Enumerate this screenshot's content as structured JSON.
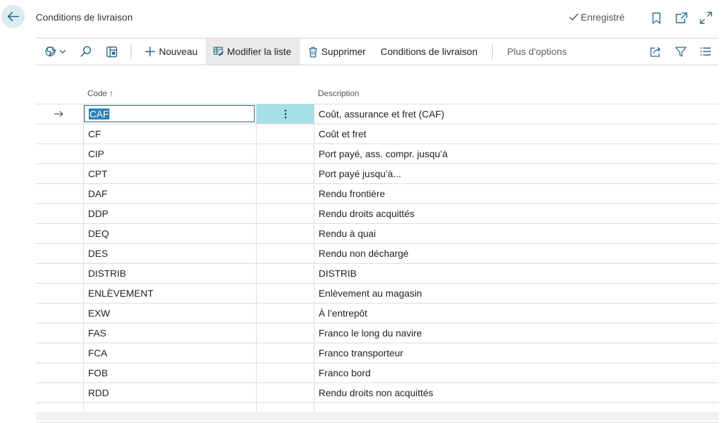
{
  "header": {
    "title": "Conditions de livraison",
    "saved_label": "Enregistré"
  },
  "toolbar": {
    "new_label": "Nouveau",
    "edit_list_label": "Modifier la liste",
    "delete_label": "Supprimer",
    "shipment_terms_label": "Conditions de livraison",
    "more_options_label": "Plus d'options"
  },
  "columns": {
    "code": "Code",
    "sort_indicator": "↑",
    "description": "Description"
  },
  "rows": [
    {
      "code": "CAF",
      "description": "Coût, assurance et fret (CAF)"
    },
    {
      "code": "CF",
      "description": "Coût et fret"
    },
    {
      "code": "CIP",
      "description": "Port payé, ass. compr. jusqu’à"
    },
    {
      "code": "CPT",
      "description": "Port payé jusqu’à..."
    },
    {
      "code": "DAF",
      "description": "Rendu frontière"
    },
    {
      "code": "DDP",
      "description": "Rendu droits acquittés"
    },
    {
      "code": "DEQ",
      "description": "Rendu à quai"
    },
    {
      "code": "DES",
      "description": "Rendu non déchargé"
    },
    {
      "code": "DISTRIB",
      "description": "DISTRIB"
    },
    {
      "code": "ENLÈVEMENT",
      "description": "Enlèvement au magasin"
    },
    {
      "code": "EXW",
      "description": "À l’entrepôt"
    },
    {
      "code": "FAS",
      "description": "Franco le long du navire"
    },
    {
      "code": "FCA",
      "description": "Franco transporteur"
    },
    {
      "code": "FOB",
      "description": "Franco bord"
    },
    {
      "code": "RDD",
      "description": "Rendu droits non acquittés"
    },
    {
      "code": "",
      "description": ""
    }
  ],
  "selected_row_index": 0,
  "colors": {
    "accent": "#23698a",
    "selection_bg": "#a5e0e7",
    "back_button_bg": "#dcebf0"
  },
  "icons": {
    "back": "arrow-left-icon",
    "saved": "checkmark-icon",
    "bookmark": "bookmark-icon",
    "open_new": "open-in-new-window-icon",
    "expand": "expand-icon",
    "analyze": "data-analysis-icon",
    "search": "search-icon",
    "filter_pane": "filter-pane-icon",
    "new": "plus-icon",
    "edit_list": "edit-list-icon",
    "delete": "trash-icon",
    "share": "share-icon",
    "filter": "filter-icon",
    "list_view": "list-view-icon",
    "row_arrow": "row-arrow-icon",
    "row_actions": "more-vertical-icon"
  }
}
